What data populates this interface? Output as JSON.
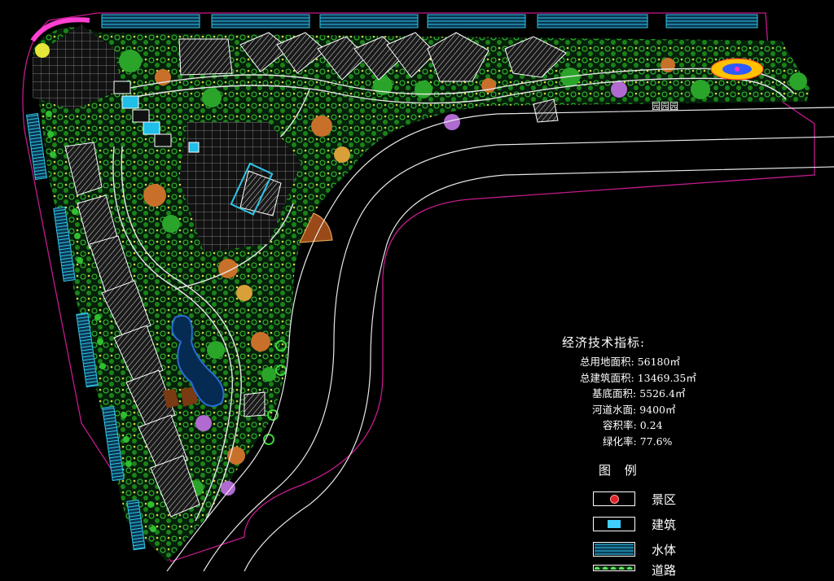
{
  "colors": {
    "background": "#000000",
    "boundary": "#c41a8c",
    "road_line": "#ffffff",
    "water_strip": "#2fc6e8",
    "tree_green": "#2fbf2f",
    "tree_orange": "#c8702a",
    "tree_purple": "#b06ad0",
    "building": "#ffffff"
  },
  "stats": {
    "title": "经济技术指标:",
    "rows": [
      {
        "label": "总用地面积:",
        "value": "56180㎡"
      },
      {
        "label": "总建筑面积:",
        "value": "13469.35㎡"
      },
      {
        "label": "基底面积:",
        "value": "5526.4㎡"
      },
      {
        "label": "河道水面:",
        "value": "9400㎡"
      },
      {
        "label": "容积率:",
        "value": "0.24"
      },
      {
        "label": "绿化率:",
        "value": "77.6%"
      }
    ]
  },
  "legend": {
    "title": "图 例",
    "items": [
      {
        "label": "景区",
        "icon": "red-dot-icon"
      },
      {
        "label": "建筑",
        "icon": "building-swatch-icon"
      },
      {
        "label": "水体",
        "icon": "water-swatch-icon"
      },
      {
        "label": "道路",
        "icon": "road-swatch-icon"
      }
    ]
  },
  "site_plan": {
    "sign_text": "园园园"
  }
}
